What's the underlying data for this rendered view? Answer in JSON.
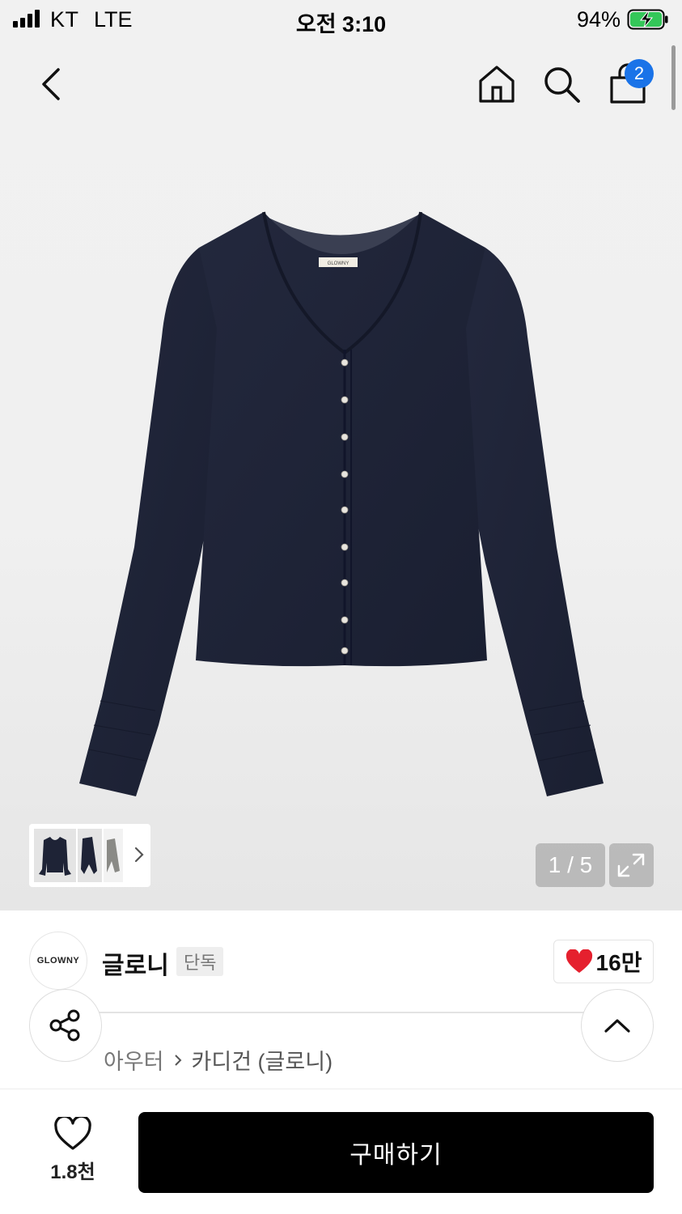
{
  "status_bar": {
    "carrier": "KT",
    "network": "LTE",
    "time": "오전 3:10",
    "battery": "94%"
  },
  "nav": {
    "cart_count": "2"
  },
  "gallery": {
    "pager": "1 / 5",
    "thumbnail_logo_text": "GLOWNY"
  },
  "brand": {
    "logo_text": "GLOWNY",
    "name": "글로니",
    "badge": "단독",
    "likes": "16만"
  },
  "breadcrumb": {
    "category": "아우터",
    "subcategory": "카디건 (글로니)"
  },
  "bottom_bar": {
    "like_count": "1.8천",
    "buy_label": "구매하기"
  },
  "colors": {
    "accent_badge": "#1a73e8",
    "heart": "#e5202e",
    "buy_button": "#000000",
    "product": "#1d2235"
  }
}
